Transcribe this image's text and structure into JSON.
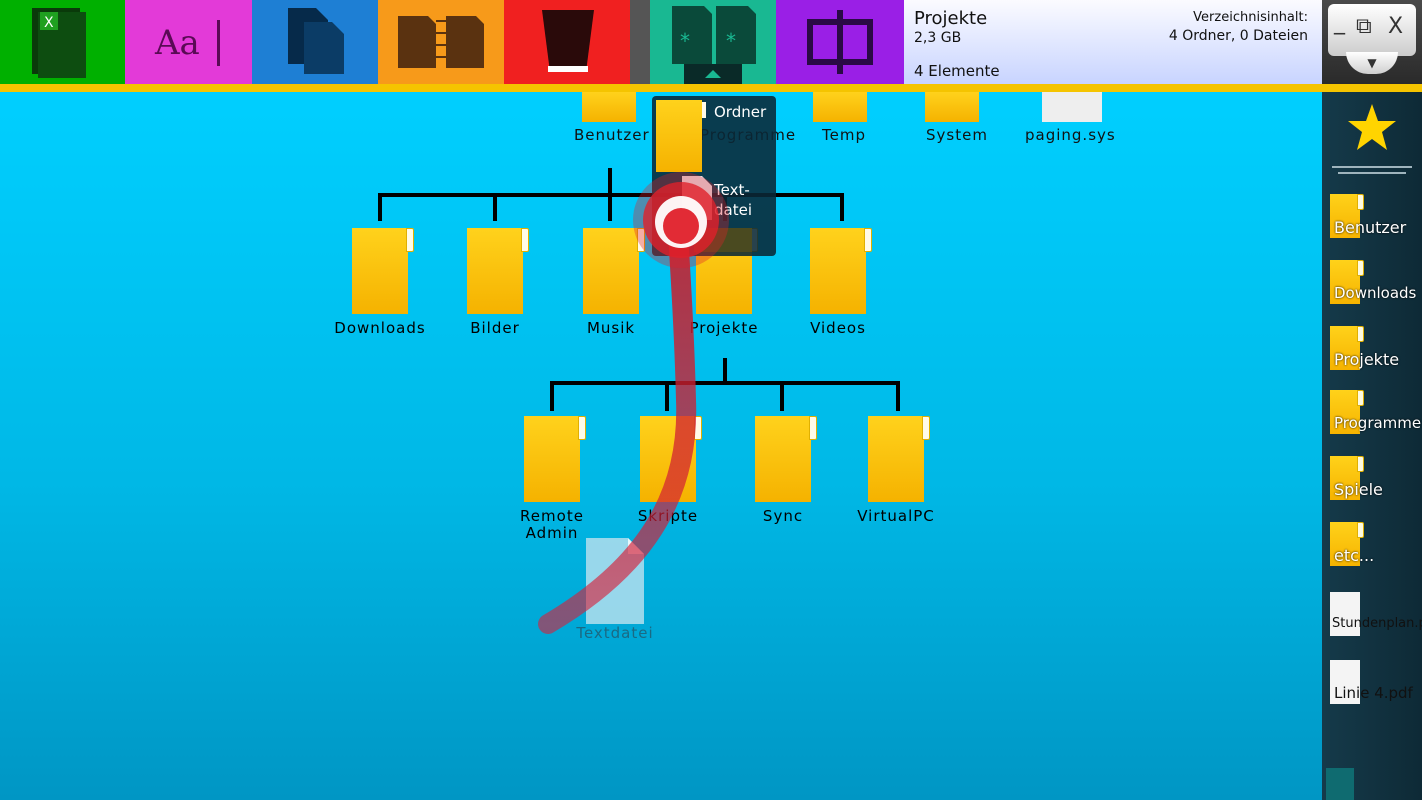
{
  "toolbar": {
    "tools": [
      {
        "name": "spreadsheet",
        "color": "#00b000"
      },
      {
        "name": "text",
        "color": "#e23ad8",
        "glyph": "Aa"
      },
      {
        "name": "copy",
        "color": "#1e7fd4"
      },
      {
        "name": "compare",
        "color": "#f79a1a"
      },
      {
        "name": "delete",
        "color": "#f02020"
      },
      {
        "name": "new-folder",
        "color": "#19b892"
      },
      {
        "name": "split",
        "color": "#9a1fe6"
      }
    ]
  },
  "info": {
    "title": "Projekte",
    "size": "2,3 GB",
    "count": "4 Elemente",
    "content_label": "Verzeichnisinhalt:",
    "content_value": "4 Ordner, 0 Dateien"
  },
  "window_controls": {
    "minimize": "_",
    "restore": "⧉",
    "close": "X",
    "dropdown": "▼"
  },
  "top_items": [
    {
      "label": "Benutzer"
    },
    {
      "label": "Programme"
    },
    {
      "label": "Temp"
    },
    {
      "label": "System"
    },
    {
      "label": "paging.sys"
    }
  ],
  "level1": [
    {
      "label": "Downloads"
    },
    {
      "label": "Bilder"
    },
    {
      "label": "Musik"
    },
    {
      "label": "Projekte"
    },
    {
      "label": "Videos"
    }
  ],
  "level2": [
    {
      "label": "Remote\nAdmin"
    },
    {
      "label": "Skripte"
    },
    {
      "label": "Sync"
    },
    {
      "label": "VirtualPC"
    }
  ],
  "dragged_file": {
    "label": "Textdatei"
  },
  "popup": {
    "folder_label": "Ordner",
    "file_label": "Text-\ndatei"
  },
  "sidebar": {
    "items": [
      {
        "label": "Benutzer",
        "kind": "folder"
      },
      {
        "label": "Downloads",
        "kind": "folder"
      },
      {
        "label": "Projekte",
        "kind": "folder"
      },
      {
        "label": "Programme",
        "kind": "folder"
      },
      {
        "label": "Spiele",
        "kind": "folder"
      },
      {
        "label": "etc...",
        "kind": "folder"
      },
      {
        "label": "Stundenplan.pdf",
        "kind": "file"
      },
      {
        "label": "Linie 4.pdf",
        "kind": "file"
      }
    ]
  }
}
